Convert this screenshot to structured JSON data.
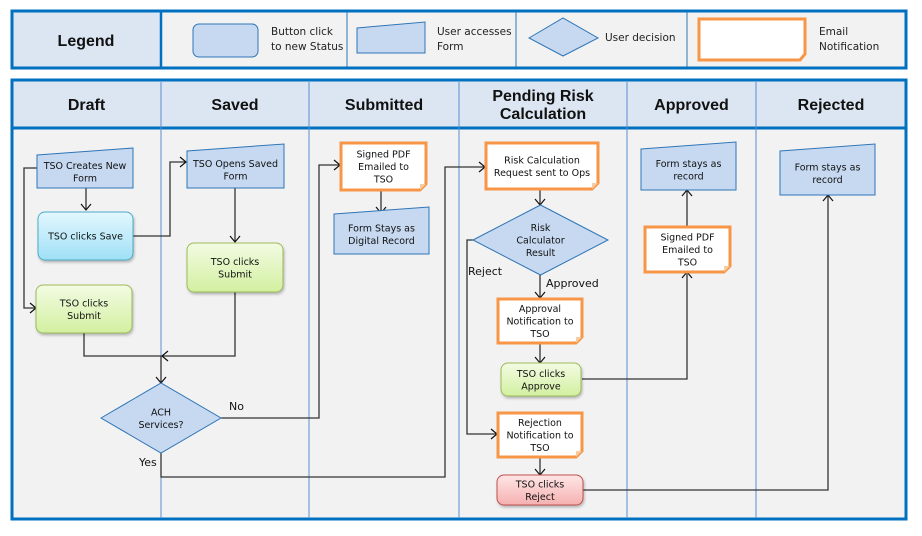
{
  "legend": {
    "title": "Legend",
    "items": [
      {
        "shape": "button",
        "label_lines": [
          "Button click",
          "to new Status"
        ]
      },
      {
        "shape": "form",
        "label_lines": [
          "User accesses",
          "Form"
        ]
      },
      {
        "shape": "decision",
        "label_lines": [
          "User decision"
        ]
      },
      {
        "shape": "email",
        "label_lines": [
          "Email",
          "Notification"
        ]
      }
    ]
  },
  "lanes": [
    {
      "title_lines": [
        "Draft"
      ]
    },
    {
      "title_lines": [
        "Saved"
      ]
    },
    {
      "title_lines": [
        "Submitted"
      ]
    },
    {
      "title_lines": [
        "Pending Risk",
        "Calculation"
      ]
    },
    {
      "title_lines": [
        "Approved"
      ]
    },
    {
      "title_lines": [
        "Rejected"
      ]
    }
  ],
  "nodes": {
    "tso_creates_new_form": {
      "type": "form",
      "lines": [
        "TSO Creates New",
        "Form"
      ]
    },
    "tso_clicks_save": {
      "type": "button-blue",
      "lines": [
        "TSO clicks Save"
      ]
    },
    "tso_clicks_submit_draft": {
      "type": "button-green",
      "lines": [
        "TSO clicks",
        "Submit"
      ]
    },
    "tso_opens_saved_form": {
      "type": "form",
      "lines": [
        "TSO Opens Saved",
        "Form"
      ]
    },
    "tso_clicks_submit_saved": {
      "type": "button-green",
      "lines": [
        "TSO clicks",
        "Submit"
      ]
    },
    "ach_services": {
      "type": "decision",
      "lines": [
        "ACH",
        "Services?"
      ]
    },
    "signed_pdf_submitted": {
      "type": "email",
      "lines": [
        "Signed PDF",
        "Emailed to",
        "TSO"
      ]
    },
    "form_stays_digital": {
      "type": "form",
      "lines": [
        "Form Stays as",
        "Digital Record"
      ]
    },
    "risk_calc_request": {
      "type": "email",
      "lines": [
        "Risk Calculation",
        "Request sent to Ops"
      ]
    },
    "risk_calc_result": {
      "type": "decision",
      "lines": [
        "Risk",
        "Calculator",
        "Result"
      ]
    },
    "approval_notification": {
      "type": "email",
      "lines": [
        "Approval",
        "Notification to",
        "TSO"
      ]
    },
    "tso_clicks_approve": {
      "type": "button-green",
      "lines": [
        "TSO clicks",
        "Approve"
      ]
    },
    "rejection_notification": {
      "type": "email",
      "lines": [
        "Rejection",
        "Notification to",
        "TSO"
      ]
    },
    "tso_clicks_reject": {
      "type": "button-red",
      "lines": [
        "TSO clicks",
        "Reject"
      ]
    },
    "form_stays_record_approved": {
      "type": "form",
      "lines": [
        "Form stays as",
        "record"
      ]
    },
    "signed_pdf_approved": {
      "type": "email",
      "lines": [
        "Signed PDF",
        "Emailed to",
        "TSO"
      ]
    },
    "form_stays_record_rejected": {
      "type": "form",
      "lines": [
        "Form stays as",
        "record"
      ]
    }
  },
  "edge_labels": {
    "no": "No",
    "yes": "Yes",
    "reject": "Reject",
    "approved": "Approved"
  },
  "colors": {
    "frame": "#0070C0",
    "header_fill": "#DCE6F2",
    "lane_fill": "#F2F2F2",
    "shape_fill": "#C6D9F1",
    "shape_stroke": "#2E75B6",
    "email_stroke": "#F79646",
    "button_green": "#D7F0A8",
    "button_blue": "#A8E4F8",
    "button_red": "#F8C0C0"
  }
}
